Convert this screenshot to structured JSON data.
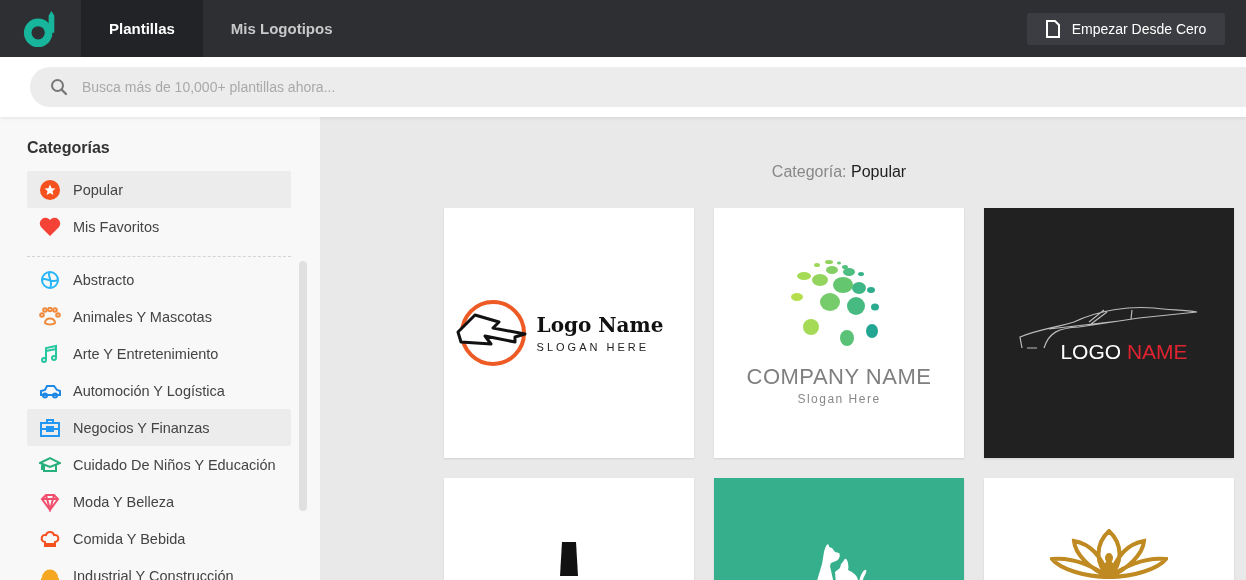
{
  "top_bar": {
    "tabs": [
      {
        "label": "Plantillas",
        "selected": true
      },
      {
        "label": "Mis Logotipos",
        "selected": false
      }
    ],
    "start_button": "Empezar Desde Cero"
  },
  "search": {
    "placeholder": "Busca más de 10,000+ plantillas ahora..."
  },
  "sidebar": {
    "title": "Categorías",
    "pinned": [
      {
        "label": "Popular",
        "kind": "star",
        "color": "#f4511e",
        "selected": true
      },
      {
        "label": "Mis Favoritos",
        "kind": "heart",
        "color": "#f44336",
        "selected": false
      }
    ],
    "categories": [
      {
        "label": "Abstracto",
        "kind": "swirl",
        "color": "#29b6f6",
        "selected": false
      },
      {
        "label": "Animales Y Mascotas",
        "kind": "paw",
        "color": "#ef8a3c",
        "selected": false
      },
      {
        "label": "Arte Y Entretenimiento",
        "kind": "music",
        "color": "#26c6a0",
        "selected": false
      },
      {
        "label": "Automoción Y Logística",
        "kind": "car",
        "color": "#1e88e5",
        "selected": false
      },
      {
        "label": "Negocios Y Finanzas",
        "kind": "briefcase",
        "color": "#2196f3",
        "selected": true
      },
      {
        "label": "Cuidado De Niños Y Educación",
        "kind": "cap",
        "color": "#26b07c",
        "selected": false
      },
      {
        "label": "Moda Y Belleza",
        "kind": "diamond",
        "color": "#f0506e",
        "selected": false
      },
      {
        "label": "Comida Y Bebida",
        "kind": "chef",
        "color": "#f4511e",
        "selected": false
      },
      {
        "label": "Industrial Y Construcción",
        "kind": "helmet",
        "color": "#f5a623",
        "selected": false
      }
    ]
  },
  "main": {
    "category_label": "Categoría:",
    "category_value": "Popular",
    "cards": [
      {
        "kind": "lightning",
        "title": "Logo Name",
        "slogan": "SLOGAN HERE"
      },
      {
        "kind": "dots",
        "title": "COMPANY NAME",
        "slogan": "Slogan Here"
      },
      {
        "kind": "car",
        "title": "LOGO",
        "title_accent": "NAME"
      },
      {
        "kind": "bottle"
      },
      {
        "kind": "pets"
      },
      {
        "kind": "lotus"
      }
    ]
  }
}
